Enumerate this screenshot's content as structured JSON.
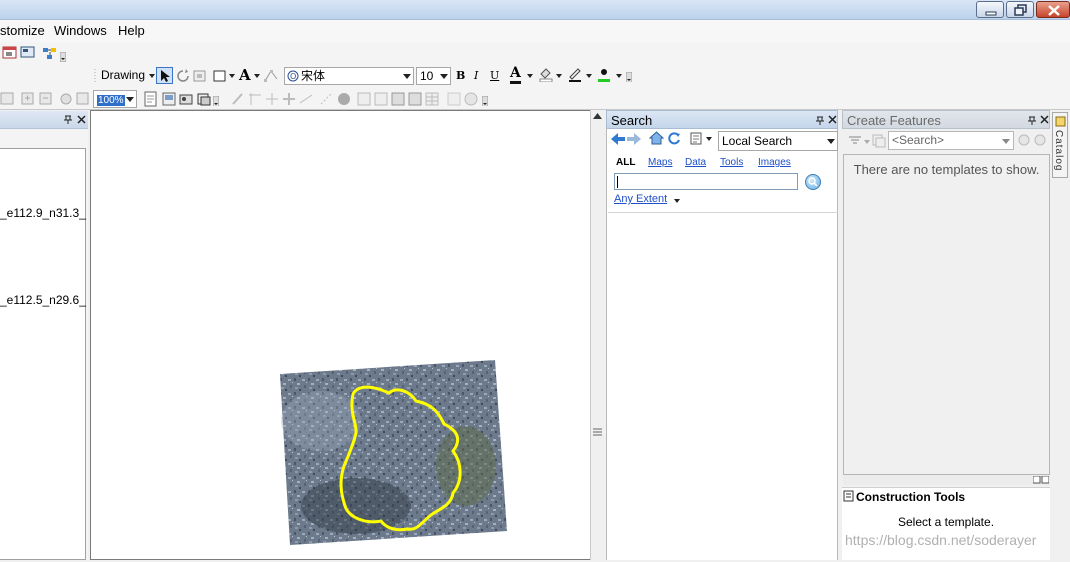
{
  "menu": {
    "items": [
      {
        "label": "stomize"
      },
      {
        "label": "Windows"
      },
      {
        "label": "Help"
      }
    ]
  },
  "drawing_toolbar": {
    "drawing_label": "Drawing",
    "font_name": "宋体",
    "font_size": "10",
    "bold": "B",
    "italic": "I",
    "underline": "U",
    "font_color_glyph": "A",
    "text_glyph": "A"
  },
  "layout_toolbar": {
    "zoom_value": "100%"
  },
  "toc": {
    "layers": [
      {
        "label": "_e112.9_n31.3_"
      },
      {
        "label": "_e112.5_n29.6_"
      }
    ]
  },
  "search": {
    "title": "Search",
    "scope": "Local Search",
    "tabs": [
      "ALL",
      "Maps",
      "Data",
      "Tools",
      "Images"
    ],
    "query": "",
    "extent_label": "Any Extent"
  },
  "create_features": {
    "title": "Create Features",
    "search_placeholder": "<Search>",
    "empty_message": "There are no templates to show."
  },
  "construction_tools": {
    "title": "Construction Tools",
    "message": "Select a template."
  },
  "catalog": {
    "tab_label": "Catalog"
  },
  "watermark": "https://blog.csdn.net/soderayer",
  "colors": {
    "outline": "#ffff00",
    "link": "#1e50c8",
    "title_bar": "#c7d9ef"
  }
}
